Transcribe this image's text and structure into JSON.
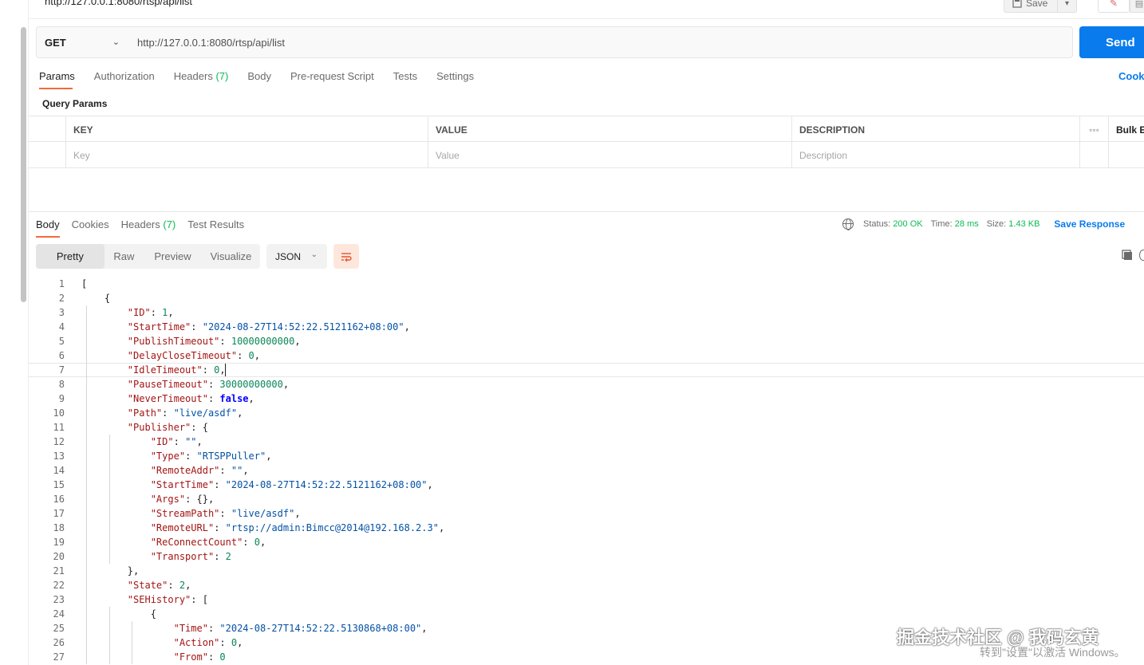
{
  "topbar": {
    "title": "http://127.0.0.1:8080/rtsp/api/list",
    "save_label": "Save"
  },
  "request": {
    "method": "GET",
    "url": "http://127.0.0.1:8080/rtsp/api/list",
    "send_label": "Send"
  },
  "req_tabs": [
    {
      "label": "Params"
    },
    {
      "label": "Authorization"
    },
    {
      "label": "Headers",
      "count": "(7)"
    },
    {
      "label": "Body"
    },
    {
      "label": "Pre-request Script"
    },
    {
      "label": "Tests"
    },
    {
      "label": "Settings"
    }
  ],
  "cookies_label": "Cooki",
  "query_params_label": "Query Params",
  "params_table": {
    "headers": [
      "KEY",
      "VALUE",
      "DESCRIPTION",
      "Bulk E"
    ],
    "placeholders": [
      "Key",
      "Value",
      "Description"
    ]
  },
  "resp_tabs": [
    {
      "label": "Body"
    },
    {
      "label": "Cookies"
    },
    {
      "label": "Headers",
      "count": "(7)"
    },
    {
      "label": "Test Results"
    }
  ],
  "status": {
    "status_label": "Status:",
    "status_value": "200 OK",
    "time_label": "Time:",
    "time_value": "28 ms",
    "size_label": "Size:",
    "size_value": "1.43 KB",
    "save_response": "Save Response"
  },
  "view_modes": [
    "Pretty",
    "Raw",
    "Preview",
    "Visualize"
  ],
  "format": "JSON",
  "code_lines": [
    "[",
    "    {",
    "        \"ID\": 1,",
    "        \"StartTime\": \"2024-08-27T14:52:22.5121162+08:00\",",
    "        \"PublishTimeout\": 10000000000,",
    "        \"DelayCloseTimeout\": 0,",
    "        \"IdleTimeout\": 0,",
    "        \"PauseTimeout\": 30000000000,",
    "        \"NeverTimeout\": false,",
    "        \"Path\": \"live/asdf\",",
    "        \"Publisher\": {",
    "            \"ID\": \"\",",
    "            \"Type\": \"RTSPPuller\",",
    "            \"RemoteAddr\": \"\",",
    "            \"StartTime\": \"2024-08-27T14:52:22.5121162+08:00\",",
    "            \"Args\": {},",
    "            \"StreamPath\": \"live/asdf\",",
    "            \"RemoteURL\": \"rtsp://admin:Bimcc@2014@192.168.2.3\",",
    "            \"ReConnectCount\": 0,",
    "            \"Transport\": 2",
    "        },",
    "        \"State\": 2,",
    "        \"SEHistory\": [",
    "            {",
    "                \"Time\": \"2024-08-27T14:52:22.5130868+08:00\",",
    "                \"Action\": 0,",
    "                \"From\": 0"
  ],
  "watermark": "掘金技术社区 @ 我码玄黄",
  "activate_text": "转到\"设置\"以激活 Windows。"
}
